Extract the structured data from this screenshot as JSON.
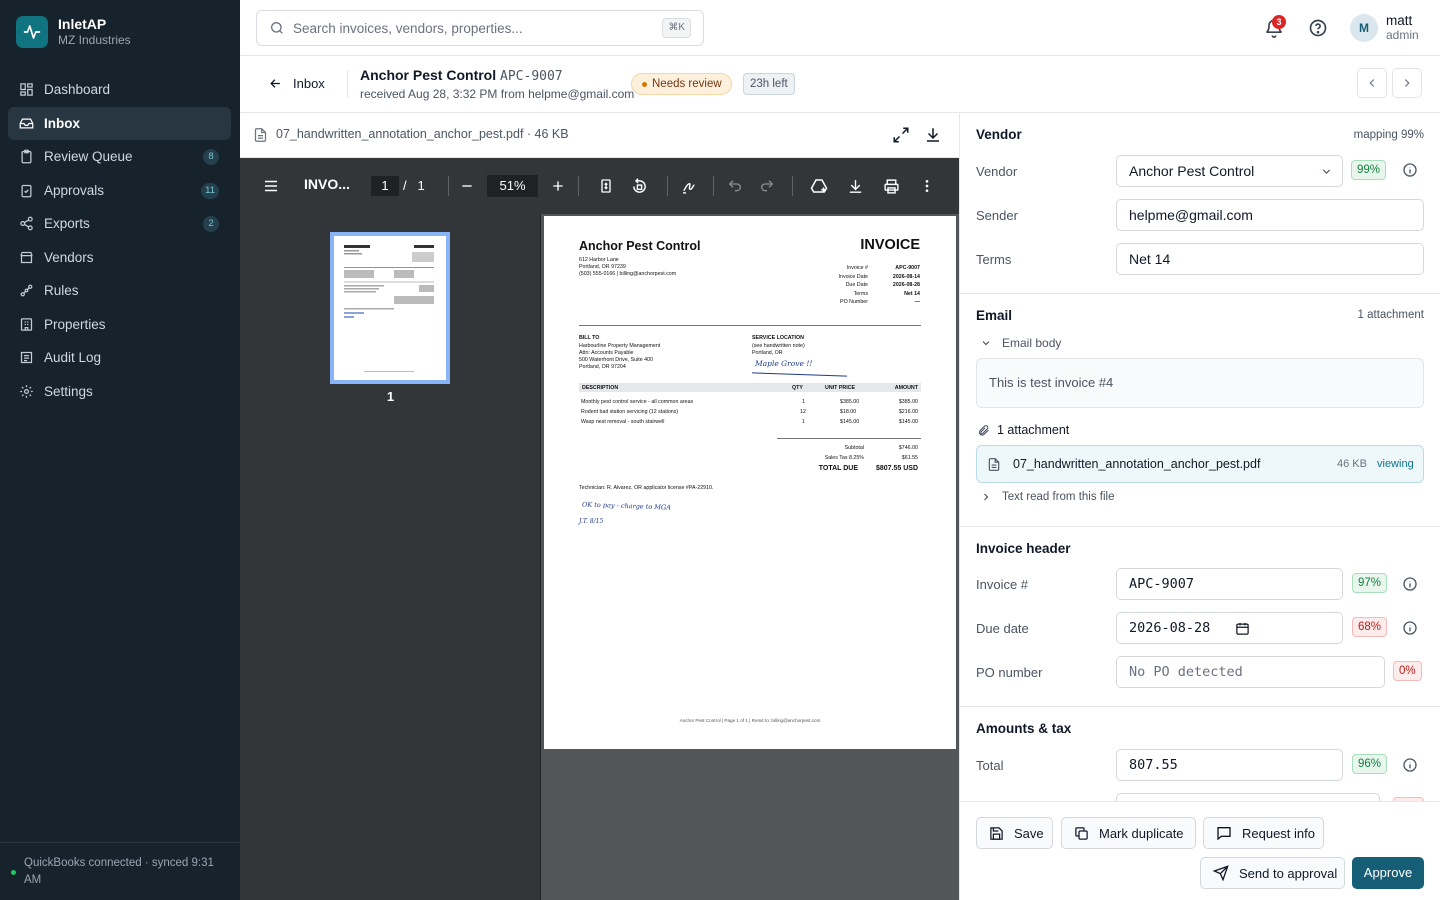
{
  "brand": {
    "name": "InletAP",
    "org": "MZ Industries"
  },
  "nav": {
    "items": [
      {
        "label": "Dashboard",
        "icon": "dashboard-icon"
      },
      {
        "label": "Inbox",
        "icon": "inbox-icon"
      },
      {
        "label": "Review Queue",
        "icon": "clipboard-icon",
        "badge": "8"
      },
      {
        "label": "Approvals",
        "icon": "clipboard-check-icon",
        "badge": "11"
      },
      {
        "label": "Exports",
        "icon": "share-icon",
        "badge": "2"
      },
      {
        "label": "Vendors",
        "icon": "store-icon"
      },
      {
        "label": "Rules",
        "icon": "workflow-icon"
      },
      {
        "label": "Properties",
        "icon": "building-icon"
      },
      {
        "label": "Audit Log",
        "icon": "log-icon"
      },
      {
        "label": "Settings",
        "icon": "gear-icon"
      }
    ]
  },
  "sidebar_footer": "QuickBooks connected · synced 9:31 AM",
  "search": {
    "placeholder": "Search invoices, vendors, properties...",
    "shortcut": "⌘K"
  },
  "notifications": {
    "count": "3"
  },
  "user": {
    "initial": "M",
    "name": "matt",
    "role": "admin"
  },
  "header": {
    "back_label": "Inbox",
    "vendor": "Anchor Pest Control",
    "invoice_number": "APC-9007",
    "received": "received Aug 28, 3:32 PM from helpme@gmail.com",
    "status": "Needs review",
    "time_left": "23h left"
  },
  "file": {
    "name": "07_handwritten_annotation_anchor_pest.pdf",
    "size": "46 KB"
  },
  "pdf_toolbar": {
    "title": "INVO...",
    "page": "1",
    "of": "/",
    "total": "1",
    "zoom": "51%"
  },
  "thumbnail": {
    "page_label": "1"
  },
  "invoice_doc": {
    "company": "Anchor Pest Control",
    "heading": "INVOICE",
    "address1": "612 Harbor Lane",
    "address2": "Portland, OR 97239",
    "contact": "(503) 555-0166  |  billing@anchorpest.com",
    "meta": [
      {
        "k": "Invoice #",
        "v": "APC-9007"
      },
      {
        "k": "Invoice Date",
        "v": "2026-08-14"
      },
      {
        "k": "Due Date",
        "v": "2026-08-28"
      },
      {
        "k": "Terms",
        "v": "Net 14"
      },
      {
        "k": "PO Number",
        "v": "—"
      }
    ],
    "bill_to_label": "BILL TO",
    "bill_to": [
      "Harbourline Property Management",
      "Attn: Accounts Payable",
      "500 Waterfront Drive, Suite 400",
      "Portland, OR 97204"
    ],
    "service_label": "SERVICE LOCATION",
    "service": [
      "(see handwritten note)",
      "Portland, OR"
    ],
    "handwritten_location": "Maple Grove !!",
    "columns": [
      "DESCRIPTION",
      "QTY",
      "UNIT PRICE",
      "AMOUNT"
    ],
    "lines": [
      {
        "desc": "Monthly pest control service - all common areas",
        "qty": "1",
        "unit": "$385.00",
        "amount": "$385.00"
      },
      {
        "desc": "Rodent bait station servicing (12 stations)",
        "qty": "12",
        "unit": "$18.00",
        "amount": "$216.00"
      },
      {
        "desc": "Wasp nest removal - south stairwell",
        "qty": "1",
        "unit": "$145.00",
        "amount": "$145.00"
      }
    ],
    "subtotal_label": "Subtotal",
    "subtotal": "$746.00",
    "tax_label": "Sales Tax 8.25%",
    "tax": "$61.55",
    "total_label": "TOTAL DUE",
    "total": "$807.55 USD",
    "technician": "Technician: R. Alvarez, OR applicator license #PA-22910.",
    "handwritten_note": "OK to pay - charge to MGA",
    "handwritten_initials": "J.T. 8/15",
    "footer": "Anchor Pest Control  |  Page 1 of 1  |  Remit to: billing@anchorpest.com"
  },
  "vendor_section": {
    "title": "Vendor",
    "mapping": "mapping 99%",
    "vendor_label": "Vendor",
    "vendor_value": "Anchor Pest Control",
    "vendor_conf": "99%",
    "sender_label": "Sender",
    "sender_value": "helpme@gmail.com",
    "terms_label": "Terms",
    "terms_value": "Net 14"
  },
  "email_section": {
    "title": "Email",
    "attachments_meta": "1 attachment",
    "body_toggle": "Email body",
    "body": "This is test invoice #4",
    "attachments_label": "1 attachment",
    "attachment_name": "07_handwritten_annotation_anchor_pest.pdf",
    "attachment_size": "46 KB",
    "attachment_status": "viewing",
    "text_toggle": "Text read from this file"
  },
  "invoice_header": {
    "title": "Invoice header",
    "invoice_label": "Invoice #",
    "invoice_value": "APC-9007",
    "invoice_conf": "97%",
    "due_label": "Due date",
    "due_value": "2026-08-28",
    "due_conf": "68%",
    "po_label": "PO number",
    "po_placeholder": "No PO detected",
    "po_conf": "0%"
  },
  "amounts": {
    "title": "Amounts & tax",
    "total_label": "Total",
    "total_value": "807.55",
    "total_conf": "96%"
  },
  "actions": {
    "save": "Save",
    "duplicate": "Mark duplicate",
    "request": "Request info",
    "approval": "Send to approval",
    "approve": "Approve"
  }
}
